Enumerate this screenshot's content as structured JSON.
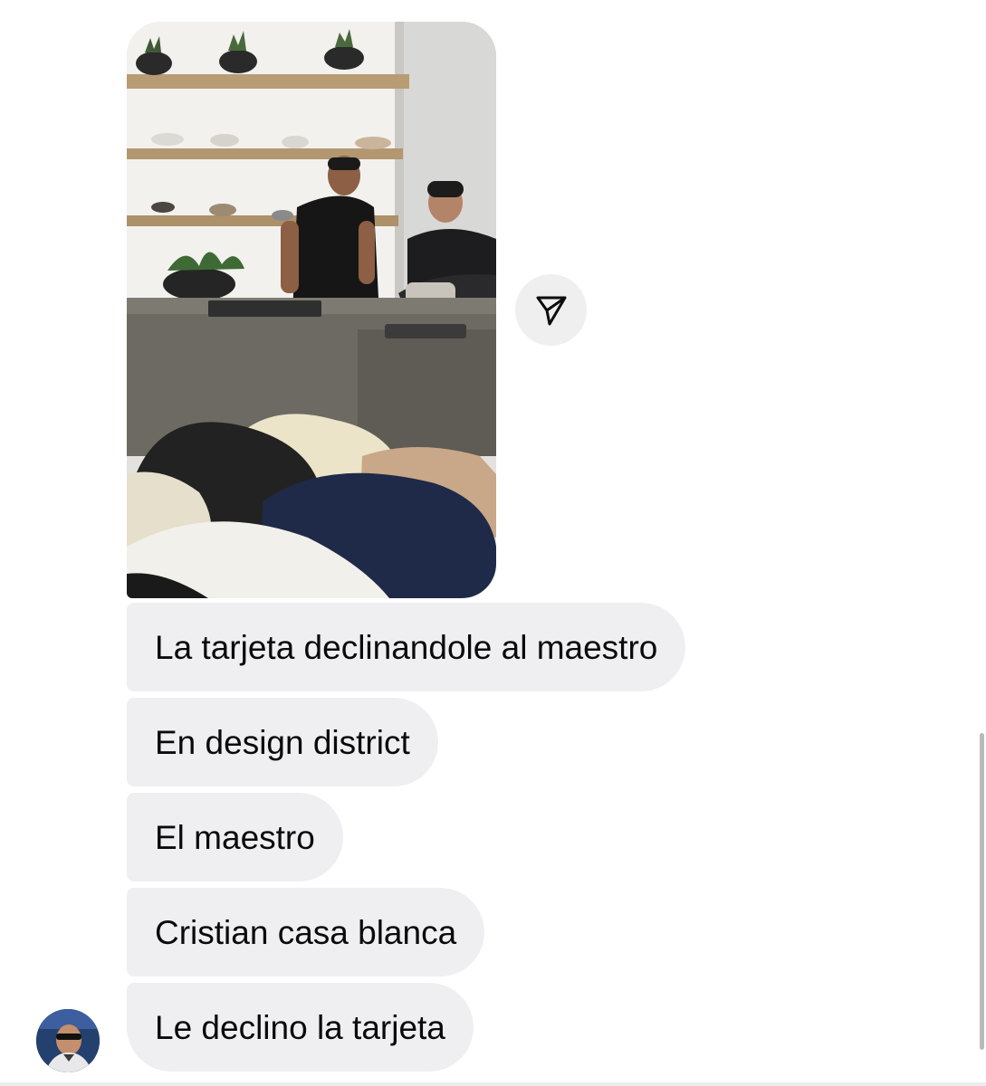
{
  "conversation": {
    "photo": {
      "icon": "shared-photo",
      "description_icon": "image"
    },
    "share_button": {
      "icon": "paper-plane-icon"
    },
    "messages": [
      {
        "text": "La tarjeta declinandole al maestro"
      },
      {
        "text": "En design district"
      },
      {
        "text": "El maestro"
      },
      {
        "text": "Cristian casa blanca"
      },
      {
        "text": "Le declino la tarjeta"
      }
    ],
    "sender": {
      "avatar_icon": "profile-avatar"
    }
  },
  "colors": {
    "bubble_background": "#efeff2",
    "text": "#0a0a0a",
    "share_button_background": "#efefef",
    "scrollbar": "#b9b9bd"
  }
}
